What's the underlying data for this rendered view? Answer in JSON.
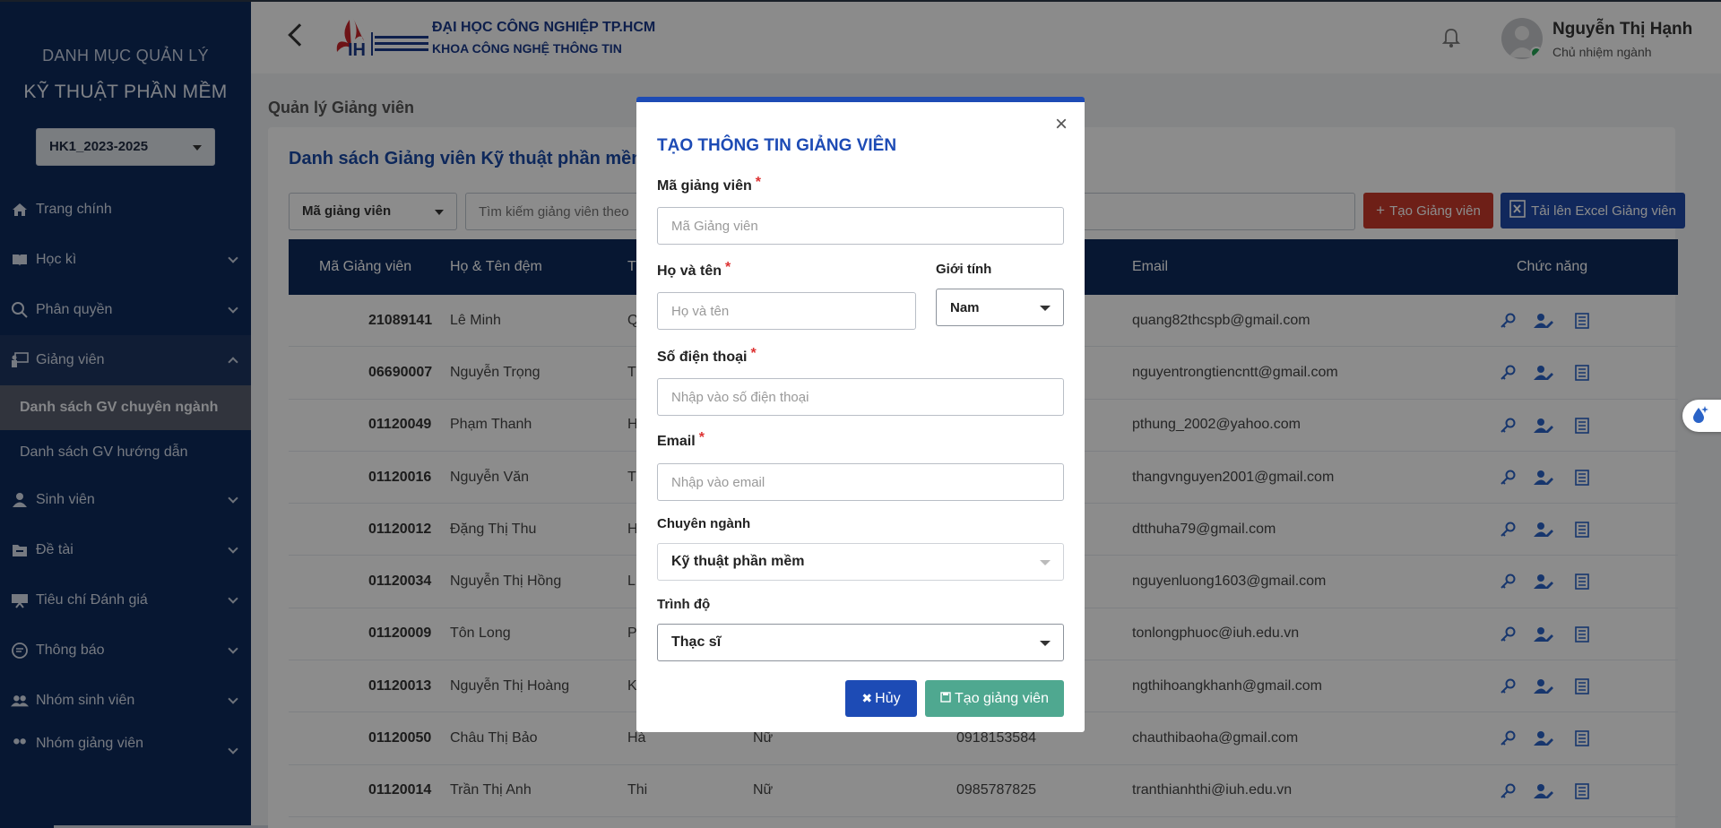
{
  "sidebar": {
    "title_line1": "DANH MỤC QUẢN LÝ",
    "title_line2": "KỸ THUẬT PHẦN MỀM",
    "term_select": "HK1_2023-2025",
    "items": {
      "home": "Trang chính",
      "semester": "Học kì",
      "permission": "Phân quyền",
      "lecturer": "Giảng viên",
      "lecturer_major_list": "Danh sách GV chuyên ngành",
      "lecturer_guide_list": "Danh sách GV hướng dẫn",
      "student": "Sinh viên",
      "topic": "Đề tài",
      "criteria": "Tiêu chí Đánh giá",
      "notice": "Thông báo",
      "student_group": "Nhóm sinh viên",
      "lecturer_group": "Nhóm giảng viên"
    }
  },
  "header": {
    "university": "ĐẠI HỌC CÔNG NGHIỆP TP.HCM",
    "faculty": "KHOA CÔNG NGHỆ THÔNG TIN",
    "user_name": "Nguyễn Thị Hạnh",
    "user_role": "Chủ nhiệm ngành"
  },
  "main": {
    "breadcrumb": "Quản lý Giảng viên",
    "card_title": "Danh sách Giảng viên Kỹ thuật phần mềm",
    "filter_select": "Mã giảng viên",
    "search_placeholder": "Tìm kiếm giảng viên theo",
    "add_button": "Tạo Giảng viên",
    "excel_button": "Tải lên Excel Giảng viên",
    "table": {
      "headers": {
        "code": "Mã Giảng viên",
        "lastname": "Họ & Tên đệm",
        "firstname": "T",
        "email": "Email",
        "actions": "Chức năng"
      },
      "rows": [
        {
          "code": "21089141",
          "lastname": "Lê Minh",
          "firstname": "Q",
          "gender": "",
          "phone": "",
          "email": "quang82thcspb@gmail.com"
        },
        {
          "code": "06690007",
          "lastname": "Nguyễn Trọng",
          "firstname": "T",
          "gender": "",
          "phone": "",
          "email": "nguyentrongtiencntt@gmail.com"
        },
        {
          "code": "01120049",
          "lastname": "Phạm Thanh",
          "firstname": "H",
          "gender": "",
          "phone": "",
          "email": "pthung_2002@yahoo.com"
        },
        {
          "code": "01120016",
          "lastname": "Nguyễn Văn",
          "firstname": "T",
          "gender": "",
          "phone": "",
          "email": "thangvnguyen2001@gmail.com"
        },
        {
          "code": "01120012",
          "lastname": "Đặng Thị Thu",
          "firstname": "H",
          "gender": "",
          "phone": "",
          "email": "dtthuha79@gmail.com"
        },
        {
          "code": "01120034",
          "lastname": "Nguyễn Thị Hồng",
          "firstname": "L",
          "gender": "",
          "phone": "",
          "email": "nguyenluong1603@gmail.com"
        },
        {
          "code": "01120009",
          "lastname": "Tôn Long",
          "firstname": "P",
          "gender": "",
          "phone": "",
          "email": "tonlongphuoc@iuh.edu.vn"
        },
        {
          "code": "01120013",
          "lastname": "Nguyễn Thị Hoàng",
          "firstname": "K",
          "gender": "",
          "phone": "",
          "email": "ngthihoangkhanh@gmail.com"
        },
        {
          "code": "01120050",
          "lastname": "Châu Thị Bảo",
          "firstname": "Hà",
          "gender": "Nữ",
          "phone": "0918153584",
          "email": "chauthibaoha@gmail.com"
        },
        {
          "code": "01120014",
          "lastname": "Trần Thị Anh",
          "firstname": "Thi",
          "gender": "Nữ",
          "phone": "0985787825",
          "email": "tranthianhthi@iuh.edu.vn"
        }
      ]
    }
  },
  "modal": {
    "title": "TẠO THÔNG TIN GIẢNG VIÊN",
    "code_label": "Mã giảng viên",
    "code_placeholder": "Mã Giảng viên",
    "name_label": "Họ và tên",
    "name_placeholder": "Họ và tên",
    "gender_label": "Giới tính",
    "gender_value": "Nam",
    "phone_label": "Số điện thoại",
    "phone_placeholder": "Nhập vào số điện thoại",
    "email_label": "Email",
    "email_placeholder": "Nhập vào email",
    "major_label": "Chuyên ngành",
    "major_value": "Kỹ thuật phần mềm",
    "degree_label": "Trình độ",
    "degree_value": "Thạc sĩ",
    "cancel_button": "Hủy",
    "create_button": "Tạo giảng viên",
    "required_mark": "*"
  },
  "colors": {
    "sidebar_bg": "#0d2a5c",
    "accent_blue": "#1d4bb5",
    "danger": "#c8392b",
    "success": "#4fa890",
    "icon_blue": "#2a63c7"
  }
}
